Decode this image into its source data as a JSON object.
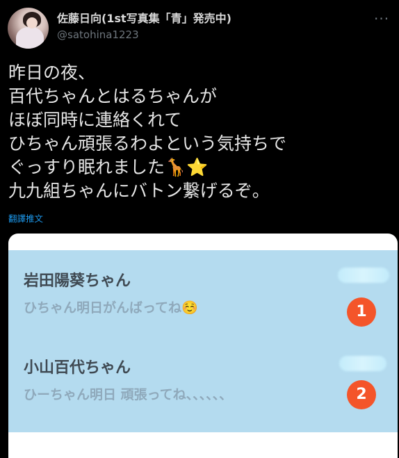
{
  "user": {
    "display_name": "佐藤日向(1st写真集「青」発売中)",
    "handle": "@satohina1223"
  },
  "tweet": {
    "lines": [
      "昨日の夜、",
      "百代ちゃんとはるちゃんが",
      "ほぼ同時に連絡くれて",
      "ひちゃん頑張るわよという気持ちで",
      "ぐっすり眠れました🦒⭐️",
      "九九組ちゃんにバトン繋げるぞ。"
    ],
    "translate_label": "翻譯推文"
  },
  "image": {
    "messages": [
      {
        "sender": "岩田陽葵ちゃん",
        "preview": "ひちゃん明日がんばってね☺️",
        "badge": "1"
      },
      {
        "sender": "小山百代ちゃん",
        "preview": "ひーちゃん明日 頑張ってね、、、、、、",
        "badge": "2"
      }
    ]
  },
  "colors": {
    "background": "#000000",
    "link": "#1d9bf0",
    "image_background": "#b4dbef",
    "badge": "#f4552a"
  },
  "icons": {
    "more": "more-options-icon"
  }
}
